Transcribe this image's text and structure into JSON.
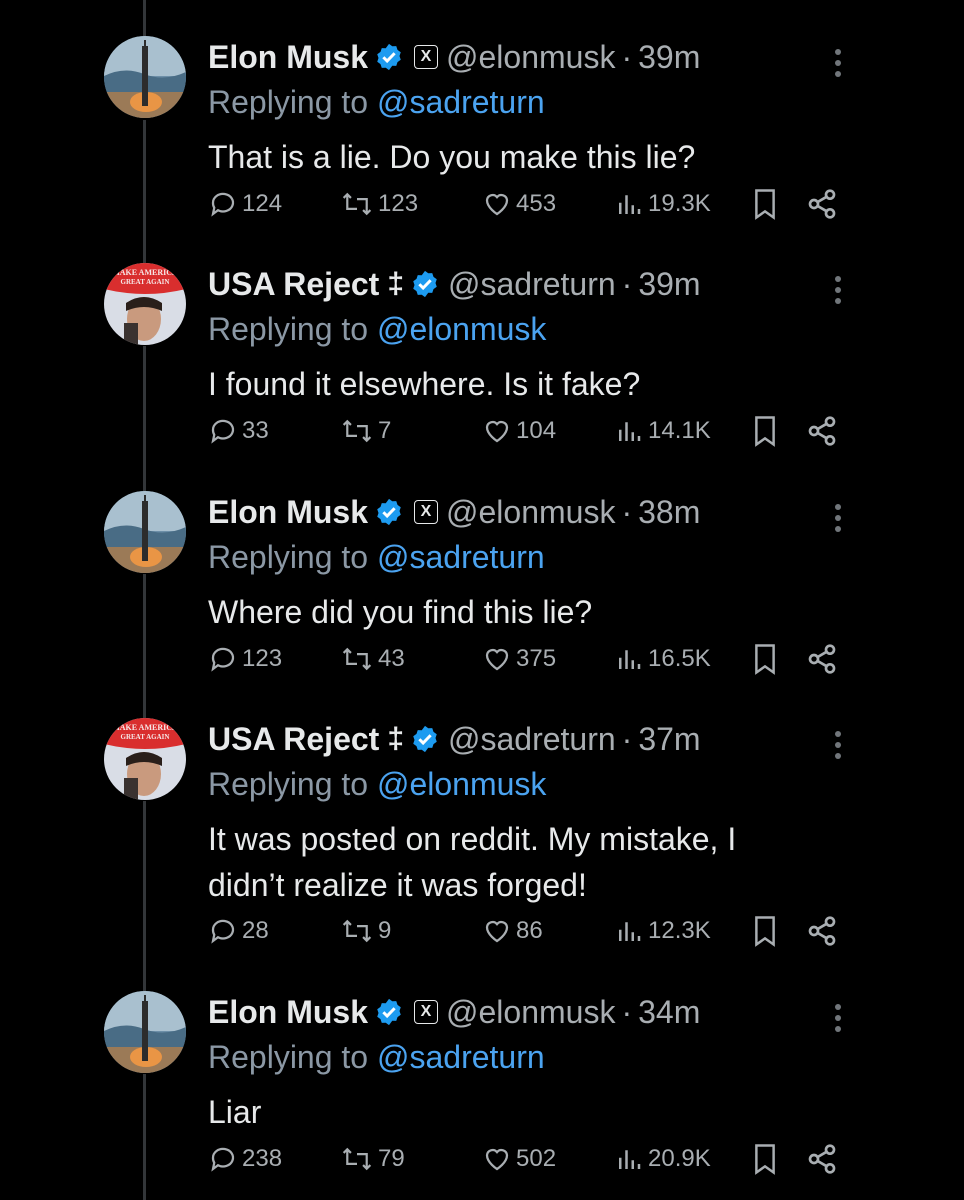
{
  "tweets": [
    {
      "author": "Elon Musk",
      "handle": "@elonmusk",
      "time": "39m",
      "affiliate": "X",
      "symbol": "",
      "replying_label": "Replying to",
      "replying_to": "@sadreturn",
      "text": "That is a lie. Do you make this lie?",
      "replies": "124",
      "reposts": "123",
      "likes": "453",
      "views": "19.3K"
    },
    {
      "author": "USA Reject",
      "handle": "@sadreturn",
      "time": "39m",
      "affiliate": "",
      "symbol": "‡",
      "replying_label": "Replying to",
      "replying_to": "@elonmusk",
      "text": "I found it elsewhere. Is it fake?",
      "replies": "33",
      "reposts": "7",
      "likes": "104",
      "views": "14.1K"
    },
    {
      "author": "Elon Musk",
      "handle": "@elonmusk",
      "time": "38m",
      "affiliate": "X",
      "symbol": "",
      "replying_label": "Replying to",
      "replying_to": "@sadreturn",
      "text": "Where did you find this lie?",
      "replies": "123",
      "reposts": "43",
      "likes": "375",
      "views": "16.5K"
    },
    {
      "author": "USA Reject",
      "handle": "@sadreturn",
      "time": "37m",
      "affiliate": "",
      "symbol": "‡",
      "replying_label": "Replying to",
      "replying_to": "@elonmusk",
      "text_line1": "It was posted on reddit. My mistake, I",
      "text_line2": "didn’t realize it was forged!",
      "replies": "28",
      "reposts": "9",
      "likes": "86",
      "views": "12.3K"
    },
    {
      "author": "Elon Musk",
      "handle": "@elonmusk",
      "time": "34m",
      "affiliate": "X",
      "symbol": "",
      "replying_label": "Replying to",
      "replying_to": "@sadreturn",
      "text": "Liar",
      "replies": "238",
      "reposts": "79",
      "likes": "502",
      "views": "20.9K"
    }
  ],
  "avatar_text": {
    "maga_line1": "MAKE AMERICA",
    "maga_line2": "GREAT AGAIN"
  },
  "colors": {
    "background": "#000000",
    "text": "#e7e9ea",
    "muted": "#a9aeb2",
    "link": "#4ba3f0",
    "verified": "#1d9bf0",
    "thread_line": "#333639"
  },
  "icons": {
    "verified": "verified-badge-icon",
    "reply": "reply-icon",
    "repost": "repost-icon",
    "like": "heart-icon",
    "views": "views-icon",
    "bookmark": "bookmark-icon",
    "share": "share-icon",
    "more": "more-vertical-icon"
  }
}
